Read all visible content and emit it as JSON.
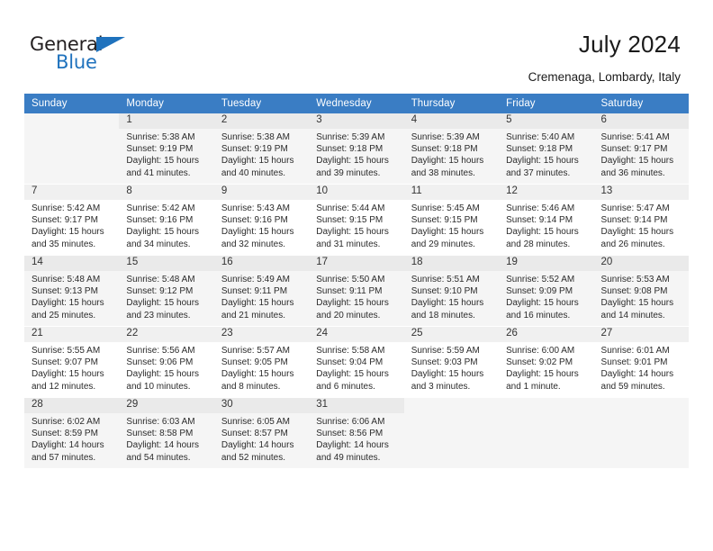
{
  "brand": {
    "name_part1": "General",
    "name_part2": "Blue",
    "accent_color": "#1f72bd"
  },
  "header": {
    "title": "July 2024",
    "location": "Cremenaga, Lombardy, Italy"
  },
  "calendar": {
    "header_background": "#3a7dc4",
    "weekdays": [
      "Sunday",
      "Monday",
      "Tuesday",
      "Wednesday",
      "Thursday",
      "Friday",
      "Saturday"
    ],
    "weeks": [
      [
        {
          "day": "",
          "sunrise": "",
          "sunset": "",
          "daylight1": "",
          "daylight2": ""
        },
        {
          "day": "1",
          "sunrise": "Sunrise: 5:38 AM",
          "sunset": "Sunset: 9:19 PM",
          "daylight1": "Daylight: 15 hours",
          "daylight2": "and 41 minutes."
        },
        {
          "day": "2",
          "sunrise": "Sunrise: 5:38 AM",
          "sunset": "Sunset: 9:19 PM",
          "daylight1": "Daylight: 15 hours",
          "daylight2": "and 40 minutes."
        },
        {
          "day": "3",
          "sunrise": "Sunrise: 5:39 AM",
          "sunset": "Sunset: 9:18 PM",
          "daylight1": "Daylight: 15 hours",
          "daylight2": "and 39 minutes."
        },
        {
          "day": "4",
          "sunrise": "Sunrise: 5:39 AM",
          "sunset": "Sunset: 9:18 PM",
          "daylight1": "Daylight: 15 hours",
          "daylight2": "and 38 minutes."
        },
        {
          "day": "5",
          "sunrise": "Sunrise: 5:40 AM",
          "sunset": "Sunset: 9:18 PM",
          "daylight1": "Daylight: 15 hours",
          "daylight2": "and 37 minutes."
        },
        {
          "day": "6",
          "sunrise": "Sunrise: 5:41 AM",
          "sunset": "Sunset: 9:17 PM",
          "daylight1": "Daylight: 15 hours",
          "daylight2": "and 36 minutes."
        }
      ],
      [
        {
          "day": "7",
          "sunrise": "Sunrise: 5:42 AM",
          "sunset": "Sunset: 9:17 PM",
          "daylight1": "Daylight: 15 hours",
          "daylight2": "and 35 minutes."
        },
        {
          "day": "8",
          "sunrise": "Sunrise: 5:42 AM",
          "sunset": "Sunset: 9:16 PM",
          "daylight1": "Daylight: 15 hours",
          "daylight2": "and 34 minutes."
        },
        {
          "day": "9",
          "sunrise": "Sunrise: 5:43 AM",
          "sunset": "Sunset: 9:16 PM",
          "daylight1": "Daylight: 15 hours",
          "daylight2": "and 32 minutes."
        },
        {
          "day": "10",
          "sunrise": "Sunrise: 5:44 AM",
          "sunset": "Sunset: 9:15 PM",
          "daylight1": "Daylight: 15 hours",
          "daylight2": "and 31 minutes."
        },
        {
          "day": "11",
          "sunrise": "Sunrise: 5:45 AM",
          "sunset": "Sunset: 9:15 PM",
          "daylight1": "Daylight: 15 hours",
          "daylight2": "and 29 minutes."
        },
        {
          "day": "12",
          "sunrise": "Sunrise: 5:46 AM",
          "sunset": "Sunset: 9:14 PM",
          "daylight1": "Daylight: 15 hours",
          "daylight2": "and 28 minutes."
        },
        {
          "day": "13",
          "sunrise": "Sunrise: 5:47 AM",
          "sunset": "Sunset: 9:14 PM",
          "daylight1": "Daylight: 15 hours",
          "daylight2": "and 26 minutes."
        }
      ],
      [
        {
          "day": "14",
          "sunrise": "Sunrise: 5:48 AM",
          "sunset": "Sunset: 9:13 PM",
          "daylight1": "Daylight: 15 hours",
          "daylight2": "and 25 minutes."
        },
        {
          "day": "15",
          "sunrise": "Sunrise: 5:48 AM",
          "sunset": "Sunset: 9:12 PM",
          "daylight1": "Daylight: 15 hours",
          "daylight2": "and 23 minutes."
        },
        {
          "day": "16",
          "sunrise": "Sunrise: 5:49 AM",
          "sunset": "Sunset: 9:11 PM",
          "daylight1": "Daylight: 15 hours",
          "daylight2": "and 21 minutes."
        },
        {
          "day": "17",
          "sunrise": "Sunrise: 5:50 AM",
          "sunset": "Sunset: 9:11 PM",
          "daylight1": "Daylight: 15 hours",
          "daylight2": "and 20 minutes."
        },
        {
          "day": "18",
          "sunrise": "Sunrise: 5:51 AM",
          "sunset": "Sunset: 9:10 PM",
          "daylight1": "Daylight: 15 hours",
          "daylight2": "and 18 minutes."
        },
        {
          "day": "19",
          "sunrise": "Sunrise: 5:52 AM",
          "sunset": "Sunset: 9:09 PM",
          "daylight1": "Daylight: 15 hours",
          "daylight2": "and 16 minutes."
        },
        {
          "day": "20",
          "sunrise": "Sunrise: 5:53 AM",
          "sunset": "Sunset: 9:08 PM",
          "daylight1": "Daylight: 15 hours",
          "daylight2": "and 14 minutes."
        }
      ],
      [
        {
          "day": "21",
          "sunrise": "Sunrise: 5:55 AM",
          "sunset": "Sunset: 9:07 PM",
          "daylight1": "Daylight: 15 hours",
          "daylight2": "and 12 minutes."
        },
        {
          "day": "22",
          "sunrise": "Sunrise: 5:56 AM",
          "sunset": "Sunset: 9:06 PM",
          "daylight1": "Daylight: 15 hours",
          "daylight2": "and 10 minutes."
        },
        {
          "day": "23",
          "sunrise": "Sunrise: 5:57 AM",
          "sunset": "Sunset: 9:05 PM",
          "daylight1": "Daylight: 15 hours",
          "daylight2": "and 8 minutes."
        },
        {
          "day": "24",
          "sunrise": "Sunrise: 5:58 AM",
          "sunset": "Sunset: 9:04 PM",
          "daylight1": "Daylight: 15 hours",
          "daylight2": "and 6 minutes."
        },
        {
          "day": "25",
          "sunrise": "Sunrise: 5:59 AM",
          "sunset": "Sunset: 9:03 PM",
          "daylight1": "Daylight: 15 hours",
          "daylight2": "and 3 minutes."
        },
        {
          "day": "26",
          "sunrise": "Sunrise: 6:00 AM",
          "sunset": "Sunset: 9:02 PM",
          "daylight1": "Daylight: 15 hours",
          "daylight2": "and 1 minute."
        },
        {
          "day": "27",
          "sunrise": "Sunrise: 6:01 AM",
          "sunset": "Sunset: 9:01 PM",
          "daylight1": "Daylight: 14 hours",
          "daylight2": "and 59 minutes."
        }
      ],
      [
        {
          "day": "28",
          "sunrise": "Sunrise: 6:02 AM",
          "sunset": "Sunset: 8:59 PM",
          "daylight1": "Daylight: 14 hours",
          "daylight2": "and 57 minutes."
        },
        {
          "day": "29",
          "sunrise": "Sunrise: 6:03 AM",
          "sunset": "Sunset: 8:58 PM",
          "daylight1": "Daylight: 14 hours",
          "daylight2": "and 54 minutes."
        },
        {
          "day": "30",
          "sunrise": "Sunrise: 6:05 AM",
          "sunset": "Sunset: 8:57 PM",
          "daylight1": "Daylight: 14 hours",
          "daylight2": "and 52 minutes."
        },
        {
          "day": "31",
          "sunrise": "Sunrise: 6:06 AM",
          "sunset": "Sunset: 8:56 PM",
          "daylight1": "Daylight: 14 hours",
          "daylight2": "and 49 minutes."
        },
        {
          "day": "",
          "sunrise": "",
          "sunset": "",
          "daylight1": "",
          "daylight2": ""
        },
        {
          "day": "",
          "sunrise": "",
          "sunset": "",
          "daylight1": "",
          "daylight2": ""
        },
        {
          "day": "",
          "sunrise": "",
          "sunset": "",
          "daylight1": "",
          "daylight2": ""
        }
      ]
    ]
  }
}
